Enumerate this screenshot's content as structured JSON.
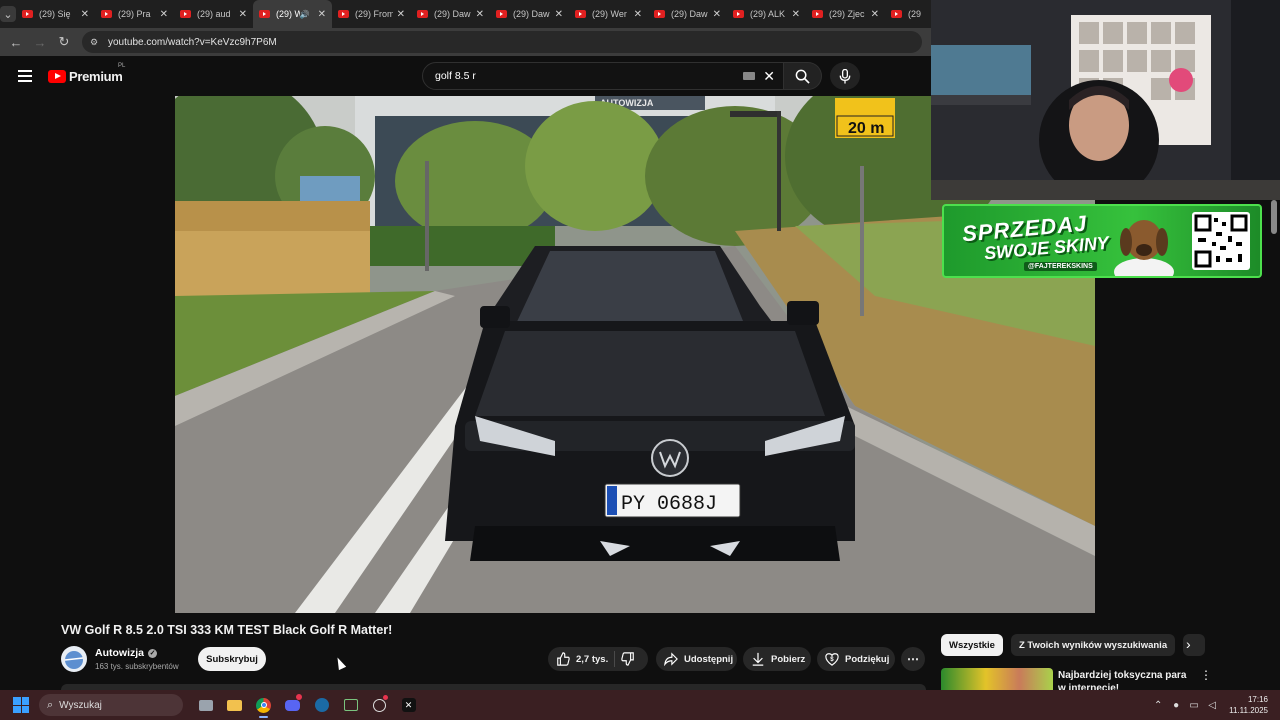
{
  "browser": {
    "tabs": [
      {
        "label": "(29) Się"
      },
      {
        "label": "(29) Pra"
      },
      {
        "label": "(29) aud"
      },
      {
        "label": "(29) W",
        "active": true,
        "audio": true
      },
      {
        "label": "(29) From"
      },
      {
        "label": "(29) Daw"
      },
      {
        "label": "(29) Daw"
      },
      {
        "label": "(29) Wer"
      },
      {
        "label": "(29) Daw"
      },
      {
        "label": "(29) ALK"
      },
      {
        "label": "(29) Zjec"
      },
      {
        "label": "(29"
      }
    ],
    "url": "youtube.com/watch?v=KeVzc9h7P6M"
  },
  "youtube": {
    "logo_text": "Premium",
    "country_code": "PL",
    "search_query": "golf 8.5 r"
  },
  "promo": {
    "line1": "SPRZEDAJ",
    "line2": "SWOJE SKINY",
    "handle": "@FAJTEREKSKINS"
  },
  "video": {
    "title": "VW Golf R 8.5 2.0 TSI 333 KM TEST Black Golf R Matter!",
    "plate": "PY 0688J",
    "sign_text": "20 m",
    "building_text": "AUTOWIZJA"
  },
  "channel": {
    "name": "Autowizja",
    "subscribers": "163 tys. subskrybentów",
    "subscribe_label": "Subskrybuj"
  },
  "actions": {
    "likes": "2,7 tys.",
    "share": "Udostępnij",
    "download": "Pobierz",
    "thanks": "Podziękuj"
  },
  "sidebar": {
    "chips": [
      "Wszystkie",
      "Z Twoich wyników wyszukiwania"
    ],
    "rec_title": "Najbardziej toksyczna para w internecie!"
  },
  "taskbar": {
    "search_placeholder": "Wyszukaj",
    "time": "17:16",
    "date": "11.11.2025"
  },
  "colors": {
    "yt_red": "#ff0000",
    "promo_green": "#36c13c",
    "taskbar": "#3a1f22"
  }
}
